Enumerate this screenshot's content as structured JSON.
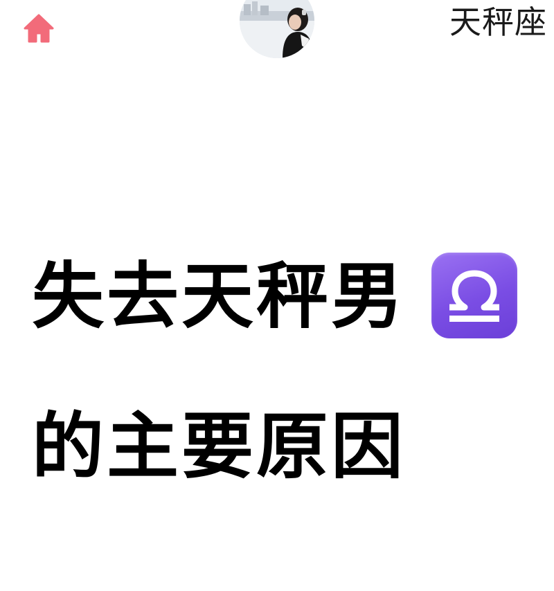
{
  "header": {
    "home_icon": "home-icon",
    "home_color": "#f26b7a",
    "avatar_icon": "profile-avatar-photo",
    "topic_tag": "天秤座"
  },
  "headline": {
    "line1": "失去天秤男",
    "badge_icon": "libra-zodiac-icon",
    "badge_color": "#7a4de4",
    "line2": "的主要原因"
  }
}
